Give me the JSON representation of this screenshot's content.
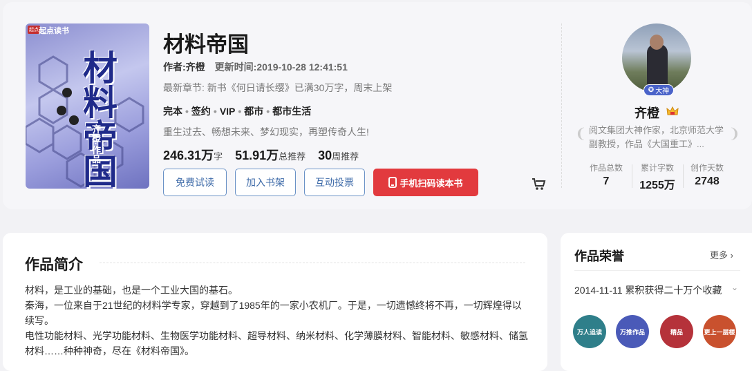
{
  "book": {
    "cover_badge": "起点",
    "cover_brand": "起点读书",
    "cover_title": "材料帝国",
    "cover_author": "齐橙·作品",
    "title": "材料帝国",
    "author": "作者:齐橙",
    "updated": "更新时间:2019-10-28 12:41:51",
    "latest_chapter": "最新章节: 新书《何日请长缨》已满30万字，周末上架",
    "tags": [
      "完本",
      "签约",
      "VIP",
      "都市",
      "都市生活"
    ],
    "tagline": "重生过去、畅想未来、梦幻现实，再塑传奇人生!",
    "stats": [
      {
        "value": "246.31万",
        "unit": "字"
      },
      {
        "value": "51.91万",
        "unit": "总推荐"
      },
      {
        "value": "30",
        "unit": "周推荐"
      }
    ]
  },
  "actions": {
    "trial": "免费试读",
    "shelf": "加入书架",
    "vote": "互动投票",
    "scan": "手机扫码读本书"
  },
  "author_card": {
    "badge": "大神",
    "name": "齐橙",
    "desc": "阅文集团大神作家，北京师范大学副教授，作品《大国重工》...",
    "stats": [
      {
        "label": "作品总数",
        "value": "7"
      },
      {
        "label": "累计字数",
        "value": "1255万"
      },
      {
        "label": "创作天数",
        "value": "2748"
      }
    ]
  },
  "intro": {
    "title": "作品简介",
    "paragraphs": [
      "材料，是工业的基础，也是一个工业大国的基石。",
      "秦海，一位来自于21世纪的材料学专家，穿越到了1985年的一家小农机厂。于是，一切遗憾终将不再，一切辉煌得以续写。",
      "电性功能材料、光学功能材料、生物医学功能材料、超导材料、纳米材料、化学薄膜材料、智能材料、敏感材料、储氢材料……种种神奇，尽在《材料帝国》。"
    ]
  },
  "honors": {
    "title": "作品荣誉",
    "more": "更多",
    "item": "2014-11-11 累积获得二十万个收藏",
    "medals": [
      {
        "label": "万人追读",
        "color": "#2f7f8a"
      },
      {
        "label": "万推作品",
        "color": "#4a5ab8"
      },
      {
        "label": "精品",
        "color": "#b5323a"
      },
      {
        "label": "更上一层楼",
        "color": "#c9512e"
      }
    ]
  }
}
